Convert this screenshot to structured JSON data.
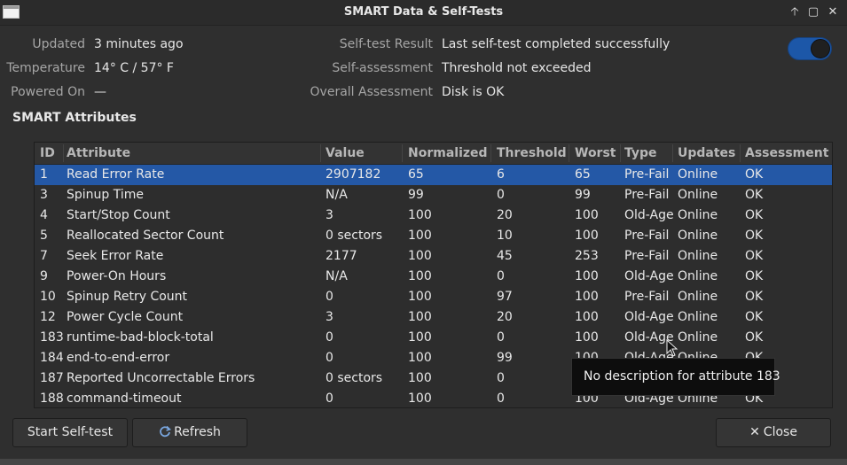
{
  "window": {
    "title": "SMART Data & Self-Tests",
    "controls": [
      "🡡",
      "▢",
      "✕"
    ]
  },
  "info": {
    "updated_label": "Updated",
    "updated_value": "3 minutes ago",
    "temperature_label": "Temperature",
    "temperature_value": "14° C / 57° F",
    "powered_on_label": "Powered On",
    "powered_on_value": "—",
    "selftest_result_label": "Self-test Result",
    "selftest_result_value": "Last self-test completed successfully",
    "self_assessment_label": "Self-assessment",
    "self_assessment_value": "Threshold not exceeded",
    "overall_label": "Overall Assessment",
    "overall_value": "Disk is OK"
  },
  "smart_toggle": {
    "state": "on",
    "color": "#1c57a8"
  },
  "section_title": "SMART Attributes",
  "table": {
    "columns": [
      "ID",
      "Attribute",
      "Value",
      "Normalized",
      "Threshold",
      "Worst",
      "Type",
      "Updates",
      "Assessment"
    ],
    "selected_index": 0,
    "rows": [
      [
        "1",
        "Read Error Rate",
        "2907182",
        "65",
        "6",
        "65",
        "Pre-Fail",
        "Online",
        "OK"
      ],
      [
        "3",
        "Spinup Time",
        "N/A",
        "99",
        "0",
        "99",
        "Pre-Fail",
        "Online",
        "OK"
      ],
      [
        "4",
        "Start/Stop Count",
        "3",
        "100",
        "20",
        "100",
        "Old-Age",
        "Online",
        "OK"
      ],
      [
        "5",
        "Reallocated Sector Count",
        "0 sectors",
        "100",
        "10",
        "100",
        "Pre-Fail",
        "Online",
        "OK"
      ],
      [
        "7",
        "Seek Error Rate",
        "2177",
        "100",
        "45",
        "253",
        "Pre-Fail",
        "Online",
        "OK"
      ],
      [
        "9",
        "Power-On Hours",
        "N/A",
        "100",
        "0",
        "100",
        "Old-Age",
        "Online",
        "OK"
      ],
      [
        "10",
        "Spinup Retry Count",
        "0",
        "100",
        "97",
        "100",
        "Pre-Fail",
        "Online",
        "OK"
      ],
      [
        "12",
        "Power Cycle Count",
        "3",
        "100",
        "20",
        "100",
        "Old-Age",
        "Online",
        "OK"
      ],
      [
        "183",
        "runtime-bad-block-total",
        "0",
        "100",
        "0",
        "100",
        "Old-Age",
        "Online",
        "OK"
      ],
      [
        "184",
        "end-to-end-error",
        "0",
        "100",
        "99",
        "100",
        "Old-Age",
        "Online",
        "OK"
      ],
      [
        "187",
        "Reported Uncorrectable Errors",
        "0 sectors",
        "100",
        "0",
        "100",
        "Old-Age",
        "Online",
        "OK"
      ],
      [
        "188",
        "command-timeout",
        "0",
        "100",
        "0",
        "100",
        "Old-Age",
        "Online",
        "OK"
      ]
    ]
  },
  "tooltip": {
    "text": "No description for attribute 183"
  },
  "buttons": {
    "start_selftest": "Start Self-test",
    "refresh": "Refresh",
    "refresh_icon": "refresh-icon",
    "close": "Close",
    "close_icon": "close-icon"
  },
  "colors": {
    "selection": "#2458a6",
    "background": "#2f2f2f"
  }
}
